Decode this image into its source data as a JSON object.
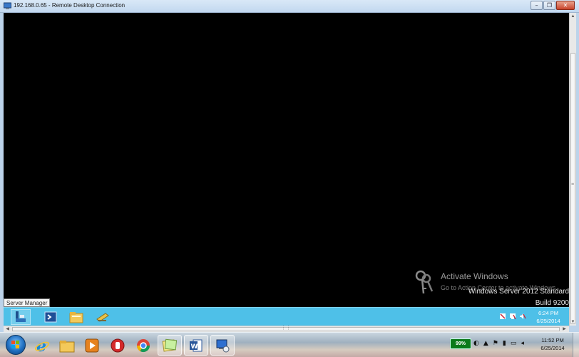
{
  "window": {
    "title": "192.168.0.65 - Remote Desktop Connection",
    "minimize_glyph": "–",
    "restore_glyph": "❐",
    "close_glyph": "✕"
  },
  "remote": {
    "watermark": {
      "title": "Activate Windows",
      "subtitle": "Go to Action Center to activate Windows.",
      "icon": "key-icon"
    },
    "os_version": "Windows Server 2012 Standard",
    "build": "Build 9200",
    "tooltip": "Server Manager",
    "taskbar": {
      "items": [
        {
          "name": "server-manager",
          "icon": "server-manager-icon"
        },
        {
          "name": "powershell",
          "icon": "powershell-icon"
        },
        {
          "name": "file-explorer",
          "icon": "folder-icon"
        },
        {
          "name": "tool",
          "icon": "tool-icon"
        }
      ],
      "clock": {
        "time": "6:24 PM",
        "date": "6/25/2014"
      }
    }
  },
  "local_taskbar": {
    "items": [
      {
        "name": "internet-explorer",
        "icon": "ie-icon"
      },
      {
        "name": "file-explorer",
        "icon": "folder-icon"
      },
      {
        "name": "media-player",
        "icon": "media-player-icon"
      },
      {
        "name": "app",
        "icon": "app-icon"
      },
      {
        "name": "chrome",
        "icon": "chrome-icon"
      },
      {
        "name": "sticky-notes",
        "icon": "sticky-notes-icon"
      },
      {
        "name": "word",
        "icon": "word-icon"
      },
      {
        "name": "remote-desktop",
        "icon": "remote-desktop-icon"
      }
    ],
    "battery": "99%",
    "clock": {
      "time": "11:52 PM",
      "date": "6/25/2014"
    },
    "colors": {
      "server_taskbar": "#4ec0e8",
      "remote_bg": "#000000"
    }
  }
}
